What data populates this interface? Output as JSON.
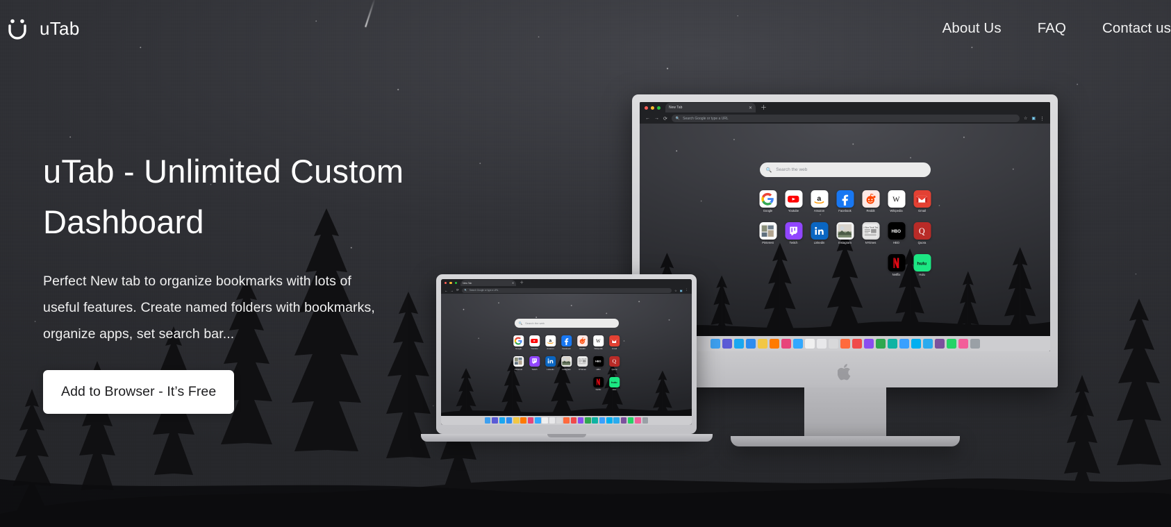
{
  "brand": {
    "name": "uTab",
    "logo_icon": "utab-smiley-icon"
  },
  "nav": {
    "items": [
      {
        "label": "About Us",
        "name": "nav-about-us"
      },
      {
        "label": "FAQ",
        "name": "nav-faq"
      },
      {
        "label": "Contact us",
        "name": "nav-contact-us"
      }
    ]
  },
  "hero": {
    "title": "uTab - Unlimited Custom Dashboard",
    "subtitle": "Perfect New tab to organize bookmarks with lots of useful features. Create named folders with bookmarks, organize apps, set search bar...",
    "cta_label": "Add to Browser - It’s Free"
  },
  "colors": {
    "cta_background": "#ffffff",
    "cta_text": "#1d1d1f",
    "nav_text": "#f2f2f2",
    "heading_text": "#ffffff",
    "browser_chrome": "#202124",
    "browser_tab_active": "#35363a"
  },
  "mockup": {
    "browser": {
      "traffic_lights": [
        "#ff5f57",
        "#febc2e",
        "#28c840"
      ],
      "tab_title": "New Tab",
      "tab_close_icon": "close-icon",
      "new_tab_icon": "plus-icon",
      "back_icon": "arrow-left-icon",
      "forward_icon": "arrow-right-icon",
      "reload_icon": "reload-icon",
      "omnibox_icon": "search-icon",
      "omnibox_placeholder": "Search Google or type a URL",
      "star_icon": "star-icon",
      "extension_icon": "extension-icon",
      "menu_icon": "kebab-menu-icon"
    },
    "newtab": {
      "search_icon": "search-icon",
      "search_placeholder": "Search the web",
      "tiles": [
        [
          {
            "label": "Google",
            "icon": "google-icon",
            "bg": "#ffffff"
          },
          {
            "label": "Youtube",
            "icon": "youtube-icon",
            "bg": "#ffffff"
          },
          {
            "label": "Amazon",
            "icon": "amazon-icon",
            "bg": "#ffffff"
          },
          {
            "label": "Facebook",
            "icon": "facebook-icon",
            "bg": "#1877f2"
          },
          {
            "label": "Reddit",
            "icon": "reddit-icon",
            "bg": "#ffe9e6"
          },
          {
            "label": "Wikipedia",
            "icon": "wikipedia-icon",
            "bg": "#ffffff"
          },
          {
            "label": "Gmail",
            "icon": "gmail-icon",
            "bg": "#e34133"
          }
        ],
        [
          {
            "label": "Pinterest",
            "icon": "pinterest-icon",
            "bg": "#ffffff"
          },
          {
            "label": "Twitch",
            "icon": "twitch-icon",
            "bg": "#9146ff"
          },
          {
            "label": "Linkedin",
            "icon": "linkedin-icon",
            "bg": "#0a66c2"
          },
          {
            "label": "Instagram",
            "icon": "instagram-icon",
            "bg": "#f3f3f3"
          },
          {
            "label": "NYtimes",
            "icon": "nytimes-icon",
            "bg": "#dedede"
          },
          {
            "label": "HBO",
            "icon": "hbo-icon",
            "bg": "#000000"
          },
          {
            "label": "Quora",
            "icon": "quora-icon",
            "bg": "#b92b27"
          }
        ],
        [
          {
            "label": "Netflix",
            "icon": "netflix-icon",
            "bg": "#000000"
          },
          {
            "label": "Hulu",
            "icon": "hulu-icon",
            "bg": "#1ce783"
          }
        ]
      ],
      "dock_icons": [
        "finder-icon",
        "launchpad-icon",
        "safari-icon",
        "mail-icon",
        "notes-icon",
        "illustrator-icon",
        "indesign-icon",
        "photoshop-icon",
        "calendar-icon",
        "reminders-icon",
        "books-icon",
        "podcasts-icon",
        "appstore-icon",
        "maps-icon",
        "messages-icon",
        "skype-icon",
        "telegram-icon",
        "viber-icon",
        "whatsapp-icon",
        "itunes-icon",
        "settings-icon",
        "downloads-icon",
        "trash-icon"
      ]
    }
  }
}
